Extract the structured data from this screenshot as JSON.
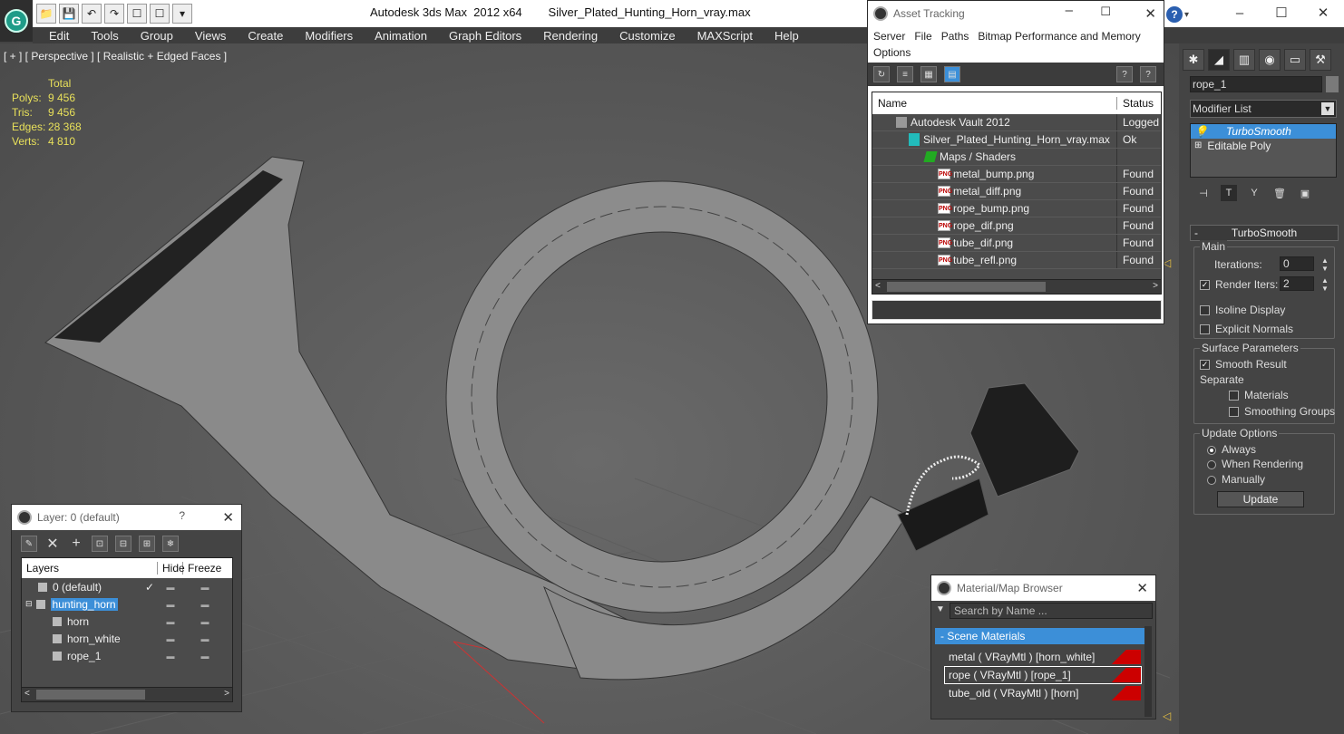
{
  "app": {
    "title": "Autodesk 3ds Max  2012 x64        Silver_Plated_Hunting_Horn_vray.max",
    "logo_letter": "G"
  },
  "window_controls": [
    "–",
    "☐",
    "✕"
  ],
  "quick_access": [
    "📁",
    "💾",
    "↶",
    "↷",
    "☐",
    "☐",
    "▾"
  ],
  "help": {
    "label": "?",
    "arrow": "▾"
  },
  "menu": [
    "Edit",
    "Tools",
    "Group",
    "Views",
    "Create",
    "Modifiers",
    "Animation",
    "Graph Editors",
    "Rendering",
    "Customize",
    "MAXScript",
    "Help"
  ],
  "viewport": {
    "label": "[ + ] [ Perspective ] [ Realistic + Edged Faces ]",
    "stats": {
      "header": "Total",
      "rows": [
        {
          "key": "Polys:",
          "value": "9 456"
        },
        {
          "key": "Tris:",
          "value": "9 456"
        },
        {
          "key": "Edges:",
          "value": "28 368"
        },
        {
          "key": "Verts:",
          "value": "4 810"
        }
      ]
    }
  },
  "asset_tracking": {
    "title": "Asset Tracking",
    "menu": [
      "Server",
      "File",
      "Paths",
      "Bitmap Performance and Memory",
      "Options"
    ],
    "columns": [
      "Name",
      "Status"
    ],
    "rows": [
      {
        "name": "Autodesk Vault 2012",
        "status": "Logged",
        "icon": "vault-icon"
      },
      {
        "name": "Silver_Plated_Hunting_Horn_vray.max",
        "status": "Ok",
        "icon": "max-file-icon"
      },
      {
        "name": "Maps / Shaders",
        "status": "",
        "icon": "maps-icon"
      },
      {
        "name": "metal_bump.png",
        "status": "Found",
        "icon": "png-icon"
      },
      {
        "name": "metal_diff.png",
        "status": "Found",
        "icon": "png-icon"
      },
      {
        "name": "rope_bump.png",
        "status": "Found",
        "icon": "png-icon"
      },
      {
        "name": "rope_dif.png",
        "status": "Found",
        "icon": "png-icon"
      },
      {
        "name": "tube_dif.png",
        "status": "Found",
        "icon": "png-icon"
      },
      {
        "name": "tube_refl.png",
        "status": "Found",
        "icon": "png-icon"
      }
    ]
  },
  "command_panel": {
    "object_name": "rope_1",
    "modifier_list": "Modifier List",
    "stack": [
      "TurboSmooth",
      "Editable Poly"
    ],
    "rollout": "TurboSmooth",
    "main_group": "Main",
    "iterations_label": "Iterations:",
    "iterations_value": "0",
    "render_iters_label": "Render Iters:",
    "render_iters_value": "2",
    "isoline_label": "Isoline Display",
    "explicit_normals_label": "Explicit Normals",
    "surface_group": "Surface Parameters",
    "smooth_result_label": "Smooth Result",
    "separate_label": "Separate",
    "materials_label": "Materials",
    "smoothing_groups_label": "Smoothing Groups",
    "update_group": "Update Options",
    "always_label": "Always",
    "when_rendering_label": "When Rendering",
    "manually_label": "Manually",
    "update_button": "Update"
  },
  "layer_dialog": {
    "title": "Layer: 0 (default)",
    "help": "?",
    "columns": [
      "Layers",
      "Hide",
      "Freeze"
    ],
    "rows": [
      {
        "name": "0 (default)",
        "check": "✓"
      },
      {
        "name": "hunting_horn",
        "check": ""
      },
      {
        "name": "horn",
        "check": ""
      },
      {
        "name": "horn_white",
        "check": ""
      },
      {
        "name": "rope_1",
        "check": ""
      }
    ]
  },
  "material_browser": {
    "title": "Material/Map Browser",
    "search_placeholder": "Search by Name ...",
    "group": "- Scene Materials",
    "items": [
      "metal  ( VRayMtl )  [horn_white]",
      "rope  ( VRayMtl )  [rope_1]",
      "tube_old  ( VRayMtl )  [horn]"
    ]
  },
  "colors": {
    "selection": "#3c8fd8",
    "stats_text": "#e8e05a",
    "material_swatch": "#cc0000"
  }
}
